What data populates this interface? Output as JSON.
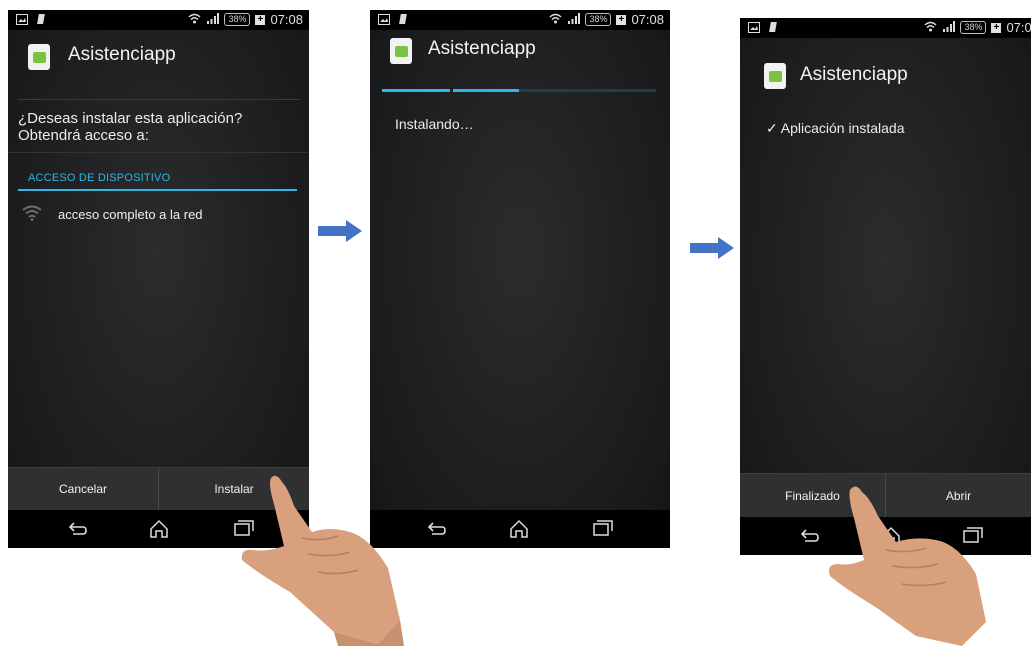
{
  "status_bar": {
    "battery": "38%",
    "battery_plus": "+",
    "time": "07:08"
  },
  "app": {
    "name": "Asistenciapp"
  },
  "screen1": {
    "prompt_line1": "¿Deseas instalar esta aplicación?",
    "prompt_line2": "Obtendrá acceso a:",
    "section": "ACCESO DE DISPOSITIVO",
    "permission": "acceso completo a la red",
    "cancel_label": "Cancelar",
    "install_label": "Instalar"
  },
  "screen2": {
    "status": "Instalando…",
    "progress": 0.5
  },
  "screen3": {
    "checkmark": "✓",
    "status": "Aplicación instalada",
    "done_label": "Finalizado",
    "open_label": "Abrir"
  },
  "nav": {
    "back": "back-icon",
    "home": "home-icon",
    "recents": "recents-icon"
  },
  "colors": {
    "accent": "#33b5e5",
    "arrow": "#4472c4",
    "skin": "#d9a07e"
  }
}
